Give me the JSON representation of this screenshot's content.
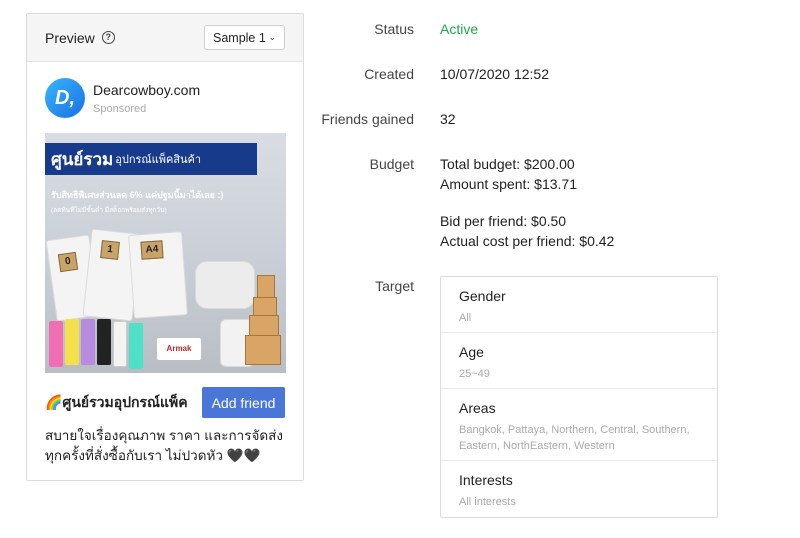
{
  "preview": {
    "title": "Preview",
    "help_icon": "question-circle-icon",
    "sample_select": {
      "value": "Sample 1"
    },
    "account": {
      "avatar_text": "D,",
      "name": "Dearcowboy.com",
      "sponsored_label": "Sponsored"
    },
    "ad_image": {
      "headline_big": "ศูนย์รวม",
      "headline_small": "อุปกรณ์แพ็คสินค้า",
      "subline": "รับสิทธิพิเศษส่วนลด 6% แค่ปฐมนิ้มาได้เลย :)",
      "fineprint": "(ลดทันทีไม่มีขั้นต่ำ มีสต็อกพร้อมส่งทุกวัน)",
      "tags": [
        "0",
        "1",
        "A4"
      ],
      "brand": "Armak"
    },
    "cta": {
      "title": "🌈ศูนย์รวมอุปกรณ์แพ็ค",
      "button_label": "Add friend"
    },
    "description": "สบายใจเรื่องคุณภาพ ราคา และการจัดส่ง ทุกครั้งที่สั่งซื้อกับเรา ไม่ปวดหัว 🖤🖤"
  },
  "details": {
    "status": {
      "label": "Status",
      "value": "Active",
      "color": "#1fa84a"
    },
    "created": {
      "label": "Created",
      "value": "10/07/2020 12:52"
    },
    "friends_gained": {
      "label": "Friends gained",
      "value": "32"
    },
    "budget": {
      "label": "Budget",
      "total": "Total budget: $200.00",
      "spent": "Amount spent: $13.71",
      "bid": "Bid per friend: $0.50",
      "actual": "Actual cost per friend: $0.42"
    },
    "target": {
      "label": "Target",
      "items": [
        {
          "title": "Gender",
          "value": "All"
        },
        {
          "title": "Age",
          "value": "25~49"
        },
        {
          "title": "Areas",
          "value": "Bangkok, Pattaya, Northern, Central, Southern, Eastern, NorthEastern, Western"
        },
        {
          "title": "Interests",
          "value": "All interests"
        }
      ]
    }
  },
  "colors": {
    "accent": "#4a76d8",
    "active": "#1fa84a",
    "banner": "#173b8a"
  }
}
